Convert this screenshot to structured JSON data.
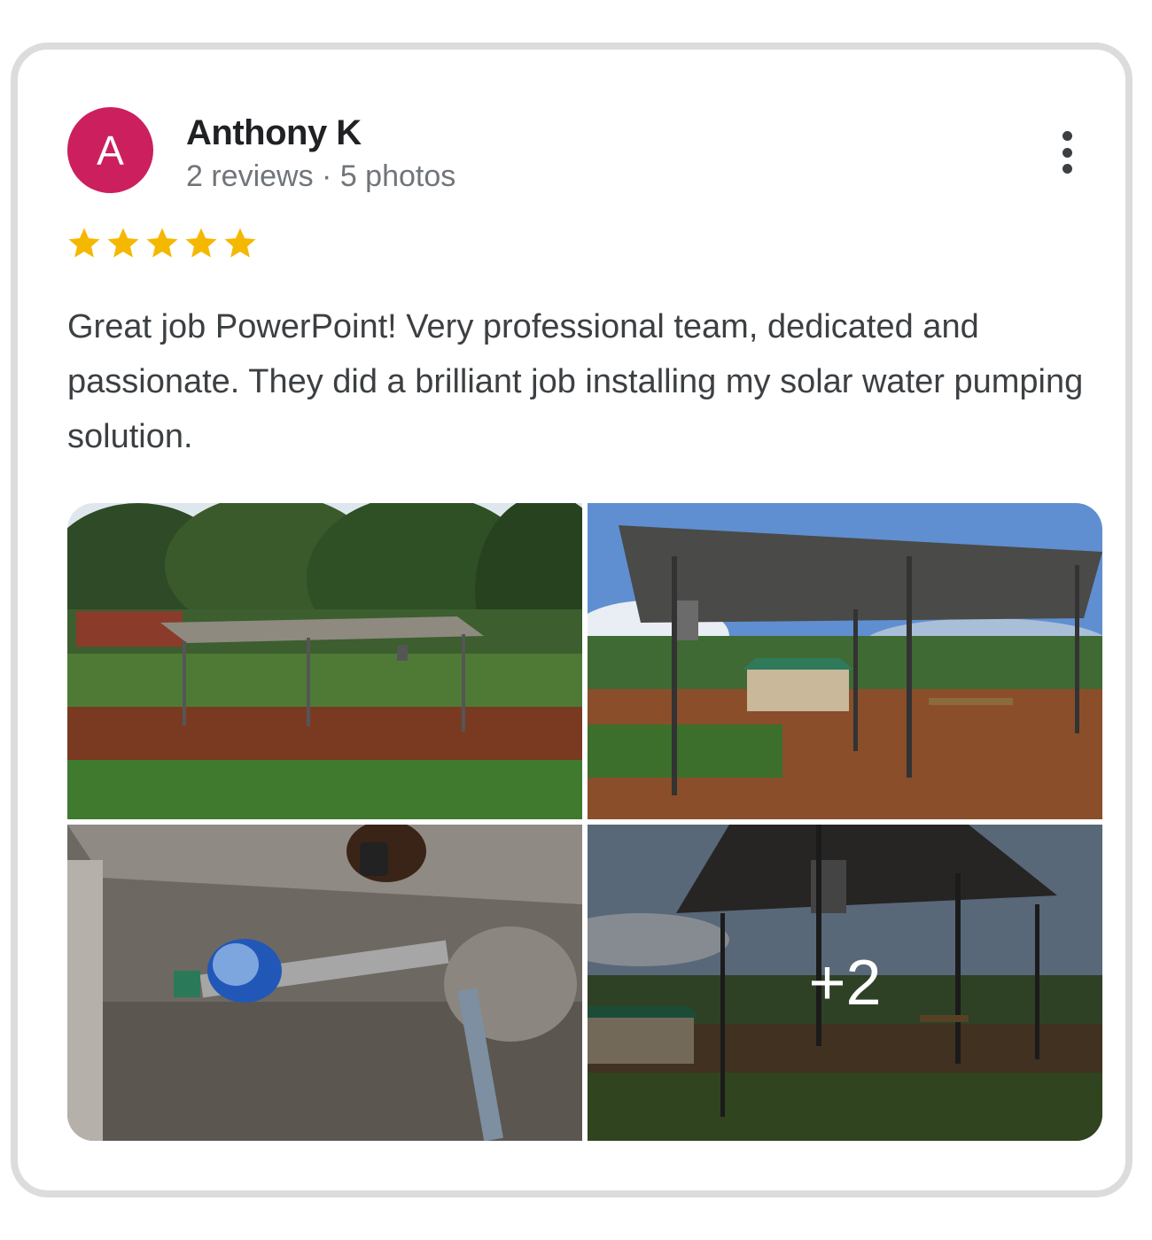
{
  "reviewer": {
    "initial": "A",
    "name": "Anthony K",
    "meta": "2 reviews · 5 photos",
    "avatar_color": "#cc1f5e"
  },
  "rating": {
    "stars": 5,
    "max": 5,
    "star_color": "#f5b800"
  },
  "review_text": "Great job PowerPoint! Very professional team, dedicated and passionate. They did a brilliant job installing my solar water pumping solution.",
  "photos": [
    {
      "subject": "solar-panel-garden-photo"
    },
    {
      "subject": "solar-panel-canopy-photo"
    },
    {
      "subject": "water-meter-pipe-photo"
    },
    {
      "subject": "solar-canopy-evening-photo",
      "more_count": "+2"
    }
  ]
}
